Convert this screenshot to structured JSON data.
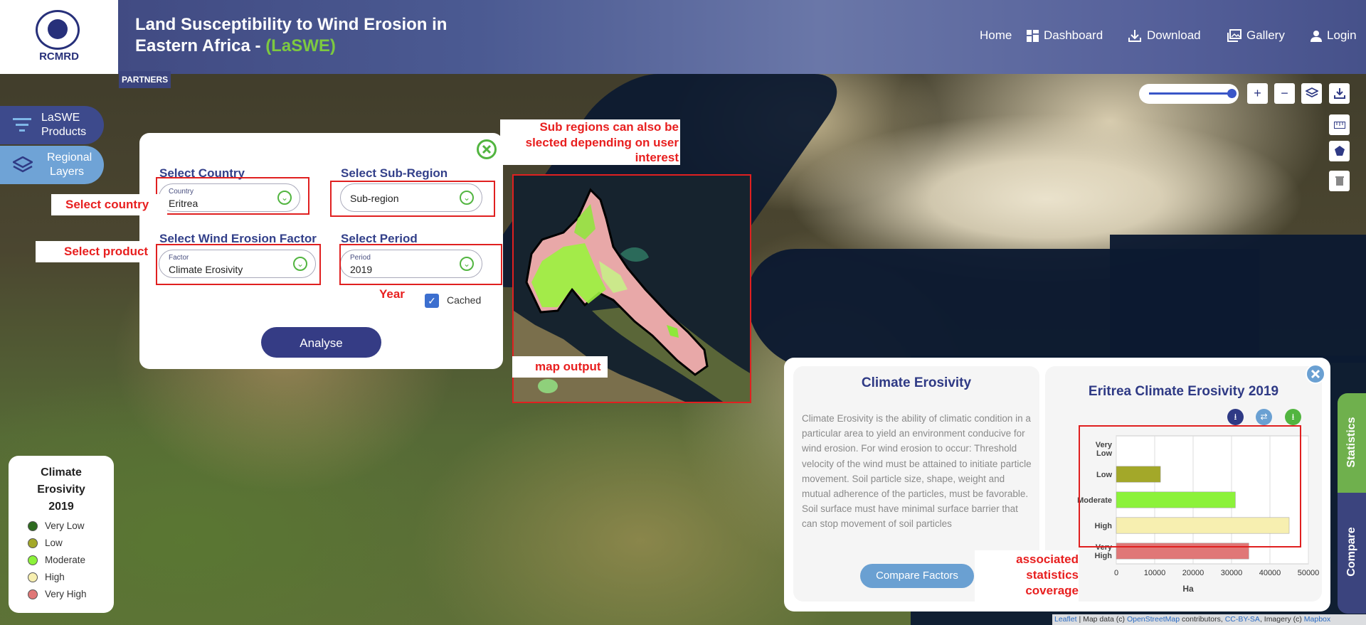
{
  "header": {
    "logo_text": "RCMRD",
    "title_line1": "Land Susceptibility to Wind Erosion in",
    "title_line2_prefix": "Eastern Africa - ",
    "title_accent": "(LaSWE)",
    "nav": [
      {
        "label": "Home",
        "icon": "none"
      },
      {
        "label": "Dashboard",
        "icon": "grid-icon"
      },
      {
        "label": "Download",
        "icon": "download-icon"
      },
      {
        "label": "Gallery",
        "icon": "gallery-icon"
      },
      {
        "label": "Login",
        "icon": "user-icon"
      }
    ],
    "partners": "PARTNERS"
  },
  "sidebar": {
    "products": "LaSWE Products",
    "products_l1": "LaSWE",
    "products_l2": "Products",
    "regional_l1": "Regional",
    "regional_l2": "Layers"
  },
  "panel": {
    "country_label": "Select Country",
    "country_small": "Country",
    "country_value": "Eritrea",
    "subregion_label": "Select Sub-Region",
    "subregion_value": "Sub-region",
    "factor_label": "Select Wind Erosion Factor",
    "factor_small": "Factor",
    "factor_value": "Climate Erosivity",
    "period_label": "Select Period",
    "period_small": "Period",
    "period_value": "2019",
    "cached_label": "Cached",
    "cached_checked": true,
    "analyse_button": "Analyse"
  },
  "annotations": {
    "select_country": "Select country",
    "select_product": "Select product",
    "year": "Year",
    "subregion_note_l1": "Sub regions can also be",
    "subregion_note_l2": "slected depending on user",
    "subregion_note_l3": "interest",
    "map_output": "map output",
    "stats_note_l1": "associated",
    "stats_note_l2": "statistics",
    "stats_note_l3": "coverage"
  },
  "stats_panel": {
    "left_title": "Climate Erosivity",
    "description": "Climate Erosivity is the ability of climatic condition in a particular area to yield an environment conducive for wind erosion. For wind erosion to occur: Threshold velocity of the wind must be attained to initiate particle movement. Soil particle size, shape, weight and mutual adherence of the particles, must be favorable. Soil surface must have minimal surface barrier that can stop movement of soil particles",
    "compare_button": "Compare Factors",
    "chart_title": "Eritrea Climate Erosivity 2019"
  },
  "chart_data": {
    "type": "bar",
    "orientation": "horizontal",
    "title": "Eritrea Climate Erosivity 2019",
    "categories": [
      "Very Low",
      "Low",
      "Moderate",
      "High",
      "Very High"
    ],
    "values": [
      0,
      11500,
      31000,
      45000,
      34500
    ],
    "colors": [
      "#2e6b1f",
      "#a3a829",
      "#8cf23a",
      "#f7efb0",
      "#e07777"
    ],
    "xlabel": "Ha",
    "xlim": [
      0,
      50000
    ],
    "xticks": [
      0,
      10000,
      20000,
      30000,
      40000,
      50000
    ],
    "grid": true
  },
  "tabs": {
    "statistics": "Statistics",
    "compare": "Compare"
  },
  "legend": {
    "title_l1": "Climate",
    "title_l2": "Erosivity",
    "title_l3": "2019",
    "items": [
      {
        "label": "Very Low",
        "color": "#2e6b1f"
      },
      {
        "label": "Low",
        "color": "#a3a829"
      },
      {
        "label": "Moderate",
        "color": "#8cf23a"
      },
      {
        "label": "High",
        "color": "#f7efb0"
      },
      {
        "label": "Very High",
        "color": "#e07777"
      }
    ]
  },
  "attribution": {
    "leaflet": "Leaflet",
    "text1": " | Map data (c) ",
    "osm": "OpenStreetMap",
    "text2": " contributors, ",
    "license": "CC-BY-SA",
    "text3": ", Imagery (c) ",
    "mapbox": "Mapbox"
  }
}
